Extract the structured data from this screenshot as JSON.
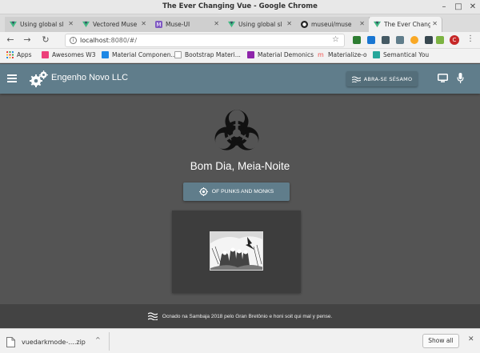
{
  "window": {
    "title": "The Ever Changing Vue - Google Chrome",
    "minimize": "–",
    "maximize": "□",
    "close": "✕"
  },
  "tabs": [
    {
      "label": "Using global sl",
      "close": "✕",
      "color": "#41b883"
    },
    {
      "label": "Vectored Muse",
      "close": "✕",
      "color": "#41b883"
    },
    {
      "label": "Muse-UI",
      "close": "✕",
      "color": "#7e57c2"
    },
    {
      "label": "Using global sl",
      "close": "✕",
      "color": "#41b883"
    },
    {
      "label": "museui/muse",
      "close": "✕",
      "color": "#222222"
    },
    {
      "label": "The Ever Chang",
      "close": "✕",
      "color": "#41b883"
    }
  ],
  "newtab": "+",
  "toolbar": {
    "back": "←",
    "forward": "→",
    "reload": "↻",
    "url_host": "localhost",
    "url_path": ":8080/#/",
    "star": "☆",
    "profile_initial": "C",
    "menu": "⋮",
    "extensions": [
      "#2e7d32",
      "#1976d2",
      "#455a64",
      "#607d8b",
      "#f9a825",
      "#37474f",
      "#7cb342",
      "#9e9e9e"
    ]
  },
  "bookmarks": [
    {
      "label": "Apps",
      "color": "#e53935"
    },
    {
      "label": "Awesomes W3",
      "color": "#ec407a"
    },
    {
      "label": "Material Componen...",
      "color": "#1e88e5"
    },
    {
      "label": "Bootstrap Materi...",
      "color": "#9e9e9e"
    },
    {
      "label": "Material Demonics",
      "color": "#8e24aa"
    },
    {
      "label": "Materialize-o",
      "color": "#ef5350"
    },
    {
      "label": "Semantical You",
      "color": "#26a69a"
    }
  ],
  "app": {
    "brand": "Engenho Novo LLC",
    "abra_button": "ABRA-SE SÉSAMO",
    "greeting": "Bom Dia, Meia-Noite",
    "punks_button": "OF PUNKS AND MONKS",
    "footer_text": "Ocnado na Sambaja 2018 pelo Gran Bretônio e honi soit qui mal y pense.",
    "colors": {
      "appbar": "#607d8b",
      "background": "#545454",
      "card": "#3d3d3d",
      "footer": "#434343"
    }
  },
  "downloads": {
    "filename": "vuedarkmode-....zip",
    "chevron": "^",
    "show_all": "Show all",
    "close": "✕"
  }
}
